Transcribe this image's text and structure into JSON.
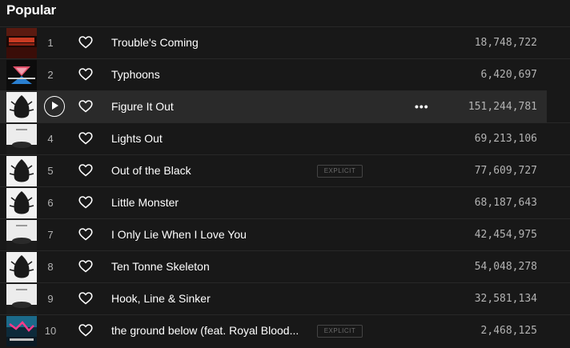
{
  "section": {
    "title": "Popular"
  },
  "tracks": [
    {
      "number": "1",
      "title": "Trouble's Coming",
      "plays": "18,748,722",
      "explicit": false,
      "art": "troubles-coming-art"
    },
    {
      "number": "2",
      "title": "Typhoons",
      "plays": "6,420,697",
      "explicit": false,
      "art": "typhoons-art"
    },
    {
      "number": "3",
      "title": "Figure It Out",
      "plays": "151,244,781",
      "explicit": false,
      "art": "royal-blood-art",
      "active": true
    },
    {
      "number": "4",
      "title": "Lights Out",
      "plays": "69,213,106",
      "explicit": false,
      "art": "how-did-we-get-so-dark-art"
    },
    {
      "number": "5",
      "title": "Out of the Black",
      "plays": "77,609,727",
      "explicit": true,
      "art": "royal-blood-art"
    },
    {
      "number": "6",
      "title": "Little Monster",
      "plays": "68,187,643",
      "explicit": false,
      "art": "royal-blood-art"
    },
    {
      "number": "7",
      "title": "I Only Lie When I Love You",
      "plays": "42,454,975",
      "explicit": false,
      "art": "how-did-we-get-so-dark-art"
    },
    {
      "number": "8",
      "title": "Ten Tonne Skeleton",
      "plays": "54,048,278",
      "explicit": false,
      "art": "royal-blood-art"
    },
    {
      "number": "9",
      "title": "Hook, Line & Sinker",
      "plays": "32,581,134",
      "explicit": false,
      "art": "how-did-we-get-so-dark-art"
    },
    {
      "number": "10",
      "title": "the ground below (feat. Royal Blood...",
      "plays": "2,468,125",
      "explicit": true,
      "art": "the-ground-below-art"
    }
  ],
  "labels": {
    "explicit": "EXPLICIT",
    "more": "•••"
  },
  "colors": {
    "background": "#181818",
    "row_hover": "#2a2a2a",
    "text_primary": "#ffffff",
    "text_secondary": "#b3b3b3"
  },
  "icons": {
    "like": "heart-outline-icon",
    "play": "play-circle-icon",
    "more": "more-options-icon"
  }
}
